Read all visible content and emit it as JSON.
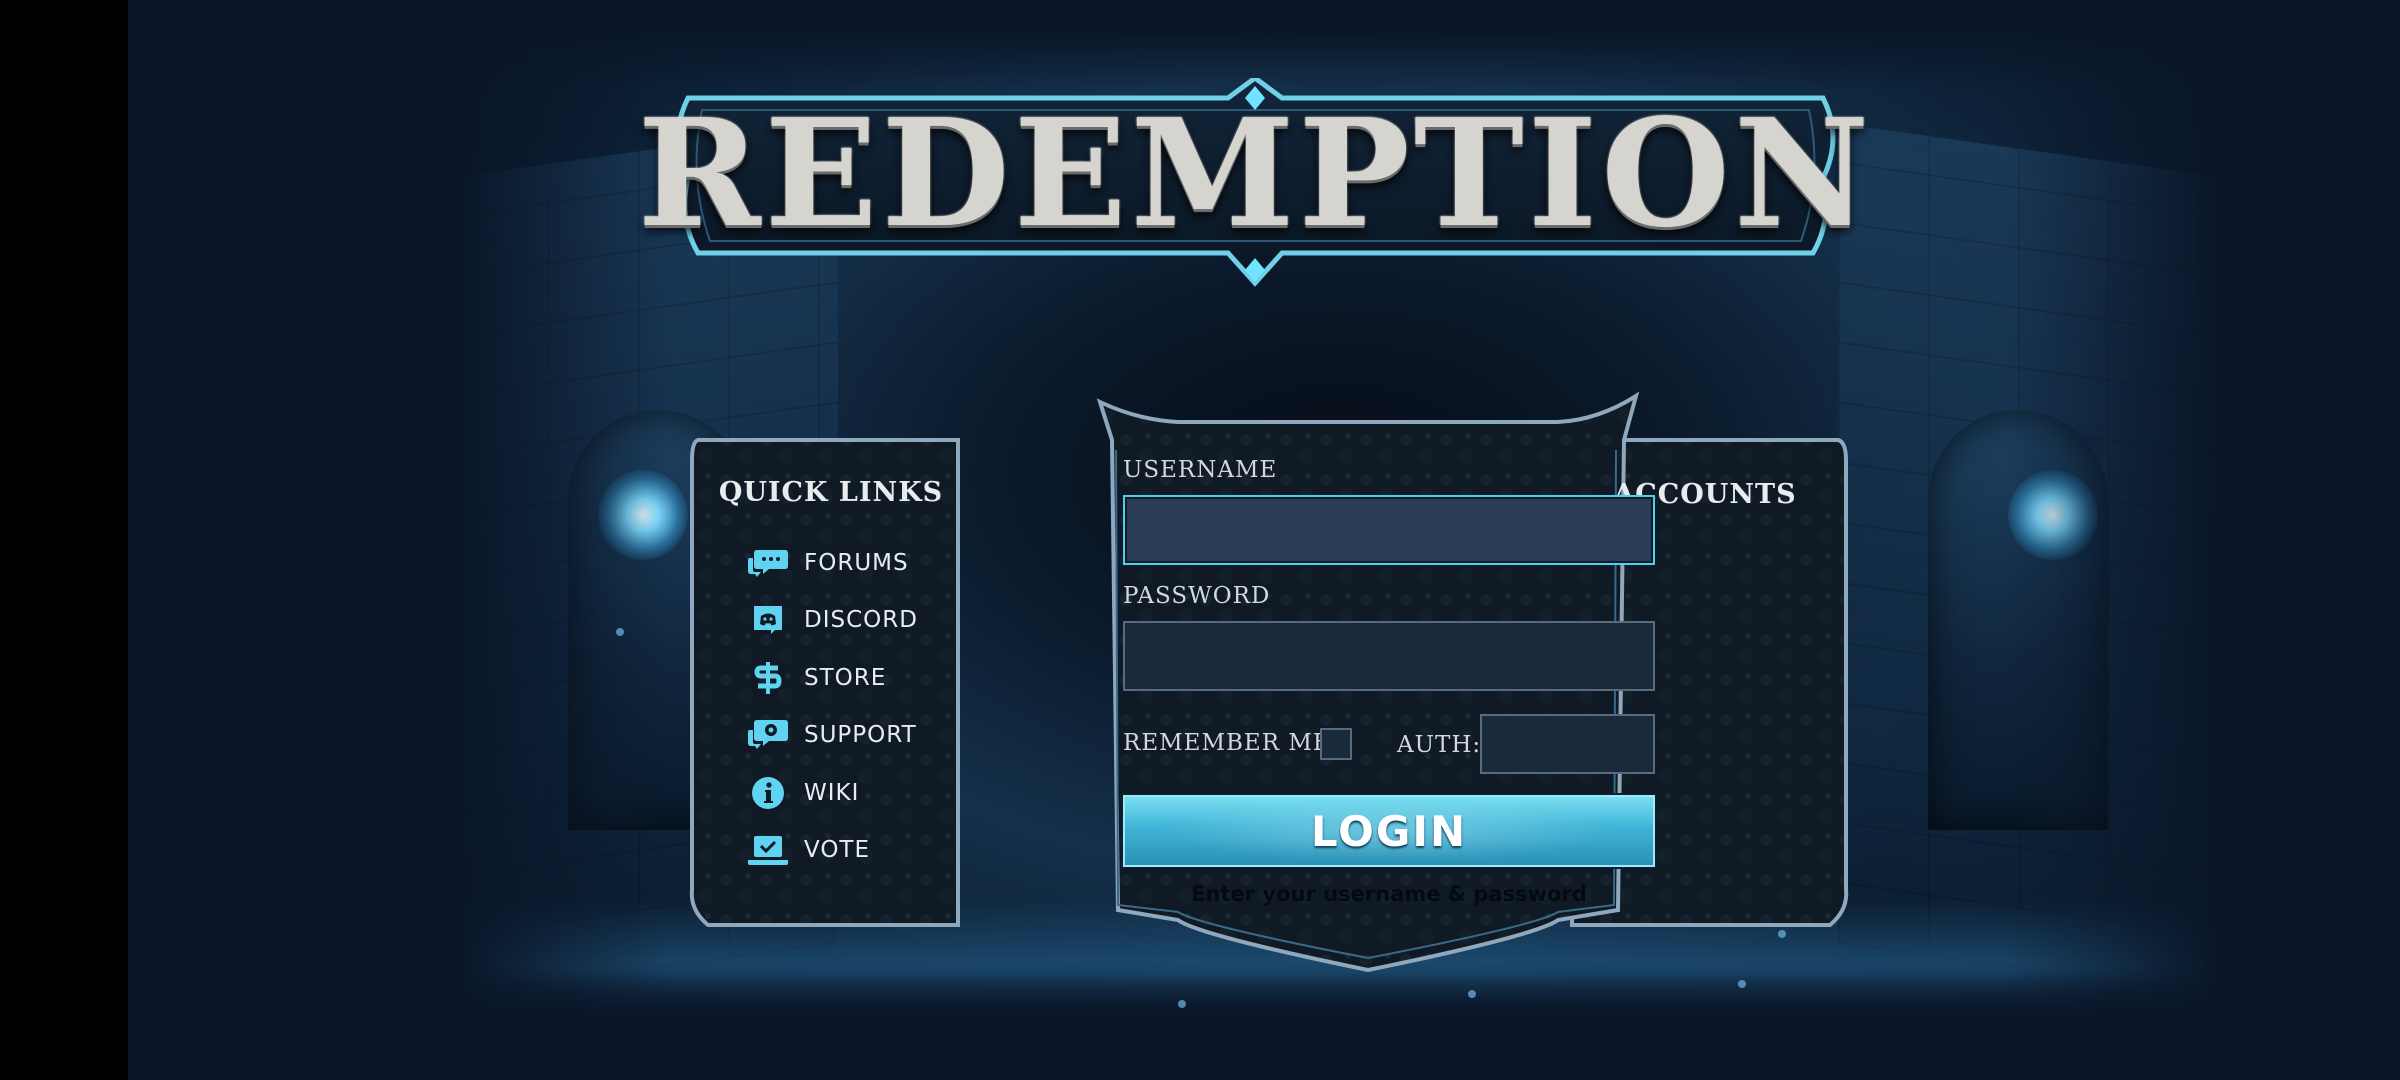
{
  "logo": {
    "text": "REDEMPTION"
  },
  "quick_links": {
    "title": "QUICK LINKS",
    "items": [
      {
        "label": "FORUMS",
        "icon": "chat-bubbles-icon"
      },
      {
        "label": "DISCORD",
        "icon": "discord-icon"
      },
      {
        "label": "STORE",
        "icon": "dollar-icon"
      },
      {
        "label": "SUPPORT",
        "icon": "support-gear-icon"
      },
      {
        "label": "WIKI",
        "icon": "info-icon"
      },
      {
        "label": "VOTE",
        "icon": "vote-laptop-icon"
      }
    ]
  },
  "accounts": {
    "title": "ACCOUNTS"
  },
  "login": {
    "username_label": "USERNAME",
    "username_value": "",
    "password_label": "PASSWORD",
    "password_value": "",
    "remember_label": "REMEMBER ME?",
    "remember_checked": false,
    "auth_label": "AUTH:",
    "auth_value": "",
    "button_label": "LOGIN",
    "hint": "Enter your username & password"
  },
  "colors": {
    "background": "#0a1628",
    "accent": "#4fd0ea",
    "icon": "#5fd3f0",
    "frame": "#7d9bb5"
  }
}
